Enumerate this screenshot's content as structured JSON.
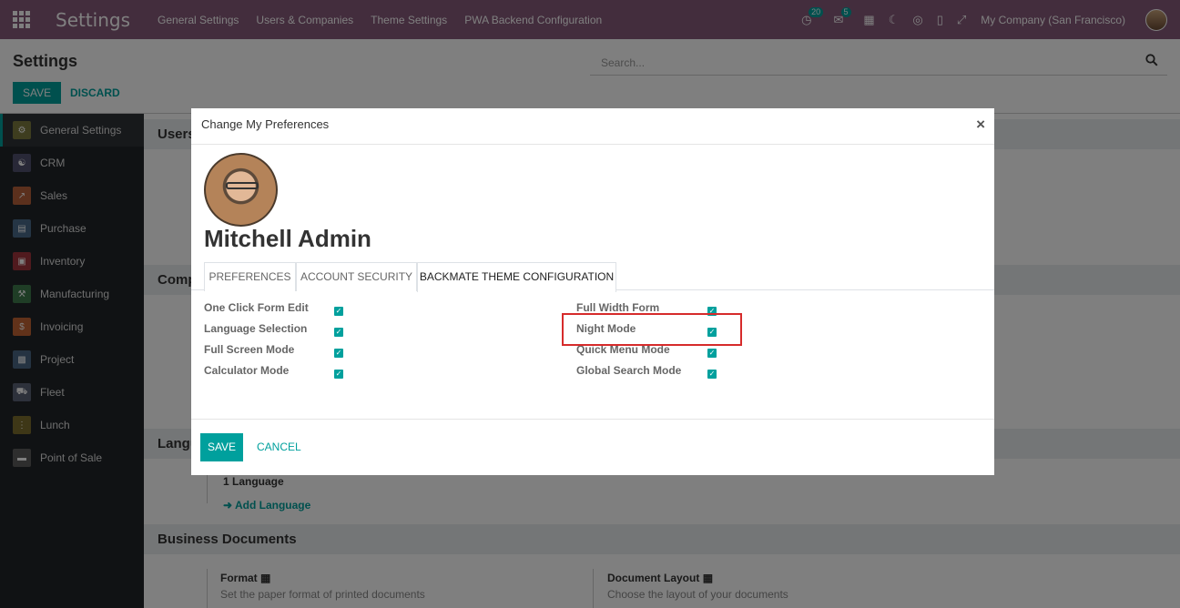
{
  "navbar": {
    "brand": "Settings",
    "menu": [
      "General Settings",
      "Users & Companies",
      "Theme Settings",
      "PWA Backend Configuration"
    ],
    "activity_count": "20",
    "messages_count": "5",
    "company": "My Company (San Francisco)"
  },
  "control_panel": {
    "title": "Settings",
    "save": "SAVE",
    "discard": "DISCARD",
    "search_placeholder": "Search..."
  },
  "sidebar": {
    "items": [
      {
        "label": "General Settings",
        "color": "#7c7b3f",
        "active": true
      },
      {
        "label": "CRM",
        "color": "#50506e"
      },
      {
        "label": "Sales",
        "color": "#b7613b"
      },
      {
        "label": "Purchase",
        "color": "#4b6a8a"
      },
      {
        "label": "Inventory",
        "color": "#a1353d"
      },
      {
        "label": "Manufacturing",
        "color": "#3e7a4c"
      },
      {
        "label": "Invoicing",
        "color": "#c36434"
      },
      {
        "label": "Project",
        "color": "#4a6684"
      },
      {
        "label": "Fleet",
        "color": "#5a6277"
      },
      {
        "label": "Lunch",
        "color": "#7d6e2e"
      },
      {
        "label": "Point of Sale",
        "color": "#5d5d5d"
      }
    ]
  },
  "main": {
    "sections": [
      "Users",
      "Comp",
      "Langu",
      "Business Documents"
    ],
    "language_count": "1 Language",
    "add_language": "Add Language",
    "format_label": "Format",
    "format_desc": "Set the paper format of printed documents",
    "doc_layout_label": "Document Layout",
    "doc_layout_desc": "Choose the layout of your documents"
  },
  "modal": {
    "title": "Change My Preferences",
    "close": "×",
    "user_name": "Mitchell Admin",
    "tabs": [
      "PREFERENCES",
      "ACCOUNT SECURITY",
      "BACKMATE THEME CONFIGURATION"
    ],
    "left_options": [
      {
        "label": "One Click Form Edit",
        "checked": true
      },
      {
        "label": "Language Selection",
        "checked": true
      },
      {
        "label": "Full Screen Mode",
        "checked": true
      },
      {
        "label": "Calculator Mode",
        "checked": true
      }
    ],
    "right_options": [
      {
        "label": "Full Width Form",
        "checked": true
      },
      {
        "label": "Night Mode",
        "checked": true
      },
      {
        "label": "Quick Menu Mode",
        "checked": true
      },
      {
        "label": "Global Search Mode",
        "checked": true
      }
    ],
    "save": "SAVE",
    "cancel": "CANCEL"
  },
  "colors": {
    "navbar": "#875a7b",
    "accent": "#00a09d",
    "highlight": "#d62b2b"
  }
}
